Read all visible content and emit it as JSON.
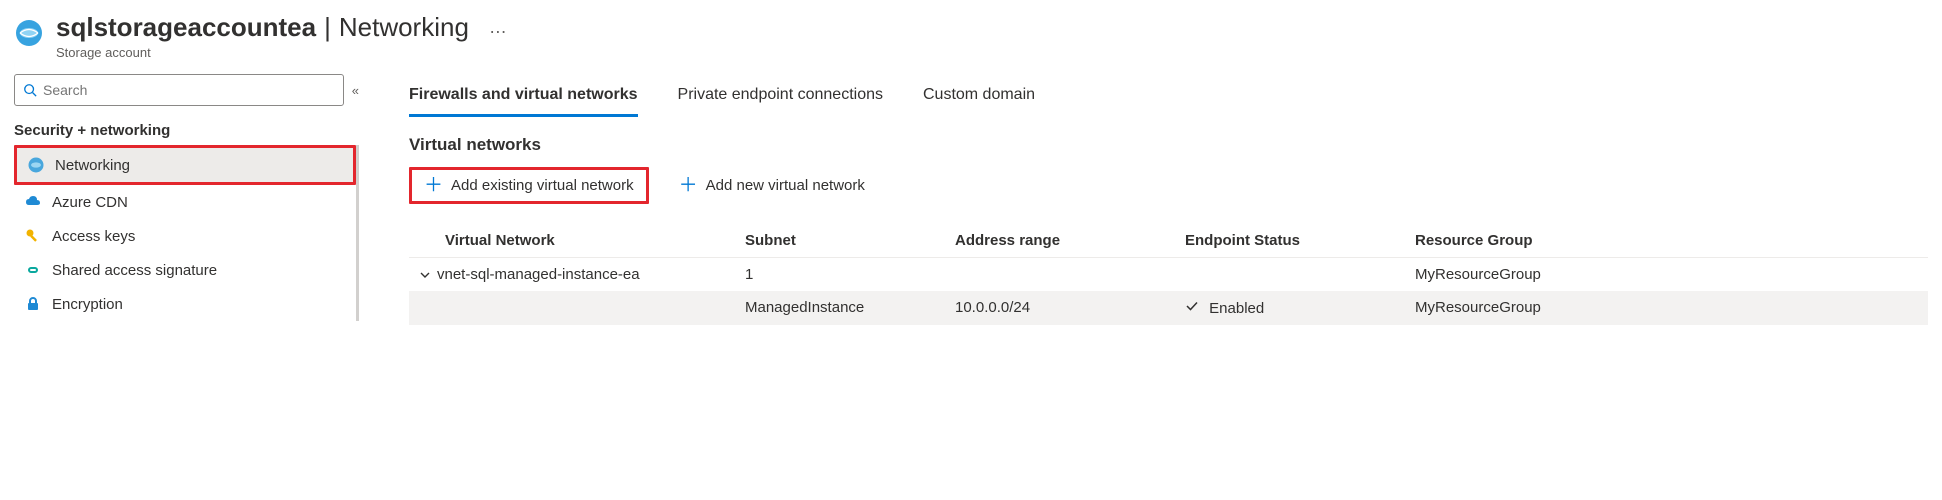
{
  "header": {
    "resource_name": "sqlstorageaccountea",
    "page": "Networking",
    "subtitle": "Storage account"
  },
  "search": {
    "placeholder": "Search"
  },
  "sidebar": {
    "section": "Security + networking",
    "items": [
      {
        "label": "Networking"
      },
      {
        "label": "Azure CDN"
      },
      {
        "label": "Access keys"
      },
      {
        "label": "Shared access signature"
      },
      {
        "label": "Encryption"
      }
    ]
  },
  "tabs": [
    {
      "label": "Firewalls and virtual networks"
    },
    {
      "label": "Private endpoint connections"
    },
    {
      "label": "Custom domain"
    }
  ],
  "vnet_section_title": "Virtual networks",
  "actions": {
    "add_existing": "Add existing virtual network",
    "add_new": "Add new virtual network"
  },
  "table": {
    "headers": {
      "c0": "Virtual Network",
      "c1": "Subnet",
      "c2": "Address range",
      "c3": "Endpoint Status",
      "c4": "Resource Group"
    },
    "row1": {
      "vnet": "vnet-sql-managed-instance-ea",
      "subnet": "1",
      "addr": "",
      "status": "",
      "rg": "MyResourceGroup"
    },
    "row2": {
      "vnet": "",
      "subnet": "ManagedInstance",
      "addr": "10.0.0.0/24",
      "status": "Enabled",
      "rg": "MyResourceGroup"
    }
  }
}
